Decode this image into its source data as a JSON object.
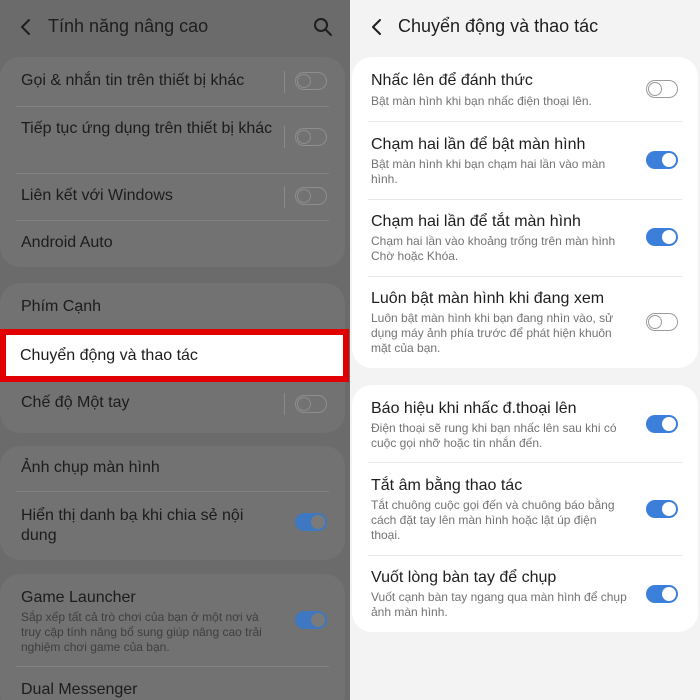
{
  "left": {
    "title": "Tính năng nâng cao",
    "items": [
      {
        "label": "Gọi & nhắn tin trên thiết bị khác"
      },
      {
        "label": "Tiếp tục ứng dụng trên thiết bị khác"
      },
      {
        "label": "Liên kết với Windows"
      },
      {
        "label": "Android Auto"
      },
      {
        "label": "Phím Cạnh"
      },
      {
        "label": "Chuyển động và thao tác"
      },
      {
        "label": "Chế độ Một tay"
      },
      {
        "label": "Ảnh chụp màn hình"
      },
      {
        "label": "Hiển thị danh bạ khi chia sẻ nội dung"
      },
      {
        "label": "Game Launcher",
        "desc": "Sắp xếp tất cả trò chơi của bạn ở một nơi và truy cập tính năng bổ sung giúp nâng cao trải nghiệm chơi game của bạn."
      },
      {
        "label": "Dual Messenger"
      }
    ],
    "toggle_states": {
      "calls": "off",
      "continue_apps": "off",
      "windows": "off",
      "one_hand": "off",
      "contacts_share": "on",
      "game_launcher": "on"
    }
  },
  "right": {
    "title": "Chuyển động và thao tác",
    "items": [
      {
        "label": "Nhấc lên để đánh thức",
        "desc": "Bật màn hình khi bạn nhấc điện thoại lên.",
        "state": "off"
      },
      {
        "label": "Chạm hai lần để bật màn hình",
        "desc": "Bật màn hình khi bạn chạm hai lần vào màn hình.",
        "state": "on"
      },
      {
        "label": "Chạm hai lần để tắt màn hình",
        "desc": "Chạm hai lần vào khoảng trống trên màn hình Chờ hoặc Khóa.",
        "state": "on"
      },
      {
        "label": "Luôn bật màn hình khi đang xem",
        "desc": "Luôn bật màn hình khi bạn đang nhìn vào, sử dụng máy ảnh phía trước để phát hiện khuôn mặt của bạn.",
        "state": "off"
      },
      {
        "label": "Báo hiệu khi nhấc đ.thoại lên",
        "desc": "Điện thoại sẽ rung khi bạn nhấc lên sau khi có cuộc gọi nhỡ hoặc tin nhắn đến.",
        "state": "on"
      },
      {
        "label": "Tắt âm bằng thao tác",
        "desc": "Tắt chuông cuộc gọi đến và chuông báo bằng cách đặt tay lên màn hình hoặc lật úp điện thoại.",
        "state": "on"
      },
      {
        "label": "Vuốt lòng bàn tay để chụp",
        "desc": "Vuốt cạnh bàn tay ngang qua màn hình để chụp ảnh màn hình.",
        "state": "on"
      }
    ]
  },
  "colors": {
    "highlight": "#e00000",
    "toggle_on": "#3b7fda"
  },
  "icons": {
    "back": "chevron-left-icon",
    "search": "search-icon"
  }
}
